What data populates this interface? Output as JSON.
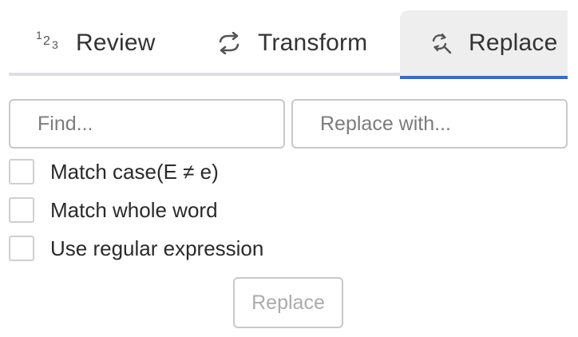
{
  "tabs": {
    "review": {
      "label": "Review",
      "icon": "numbers-123-icon"
    },
    "transform": {
      "label": "Transform",
      "icon": "transform-arrows-icon"
    },
    "replace": {
      "label": "Replace",
      "icon": "search-replace-icon",
      "active": true
    }
  },
  "find": {
    "placeholder": "Find...",
    "value": ""
  },
  "replace_with": {
    "placeholder": "Replace with...",
    "value": ""
  },
  "options": {
    "match_case": {
      "label": "Match case(E ≠ e)",
      "checked": false
    },
    "whole_word": {
      "label": "Match whole word",
      "checked": false
    },
    "regex": {
      "label": "Use regular expression",
      "checked": false
    }
  },
  "button": {
    "label": "Replace",
    "disabled": true
  },
  "colors": {
    "accent": "#2f6fd6",
    "active_tab_bg": "#eeeeef",
    "tab_divider": "#dcdee3",
    "border": "#c8c8c8"
  }
}
